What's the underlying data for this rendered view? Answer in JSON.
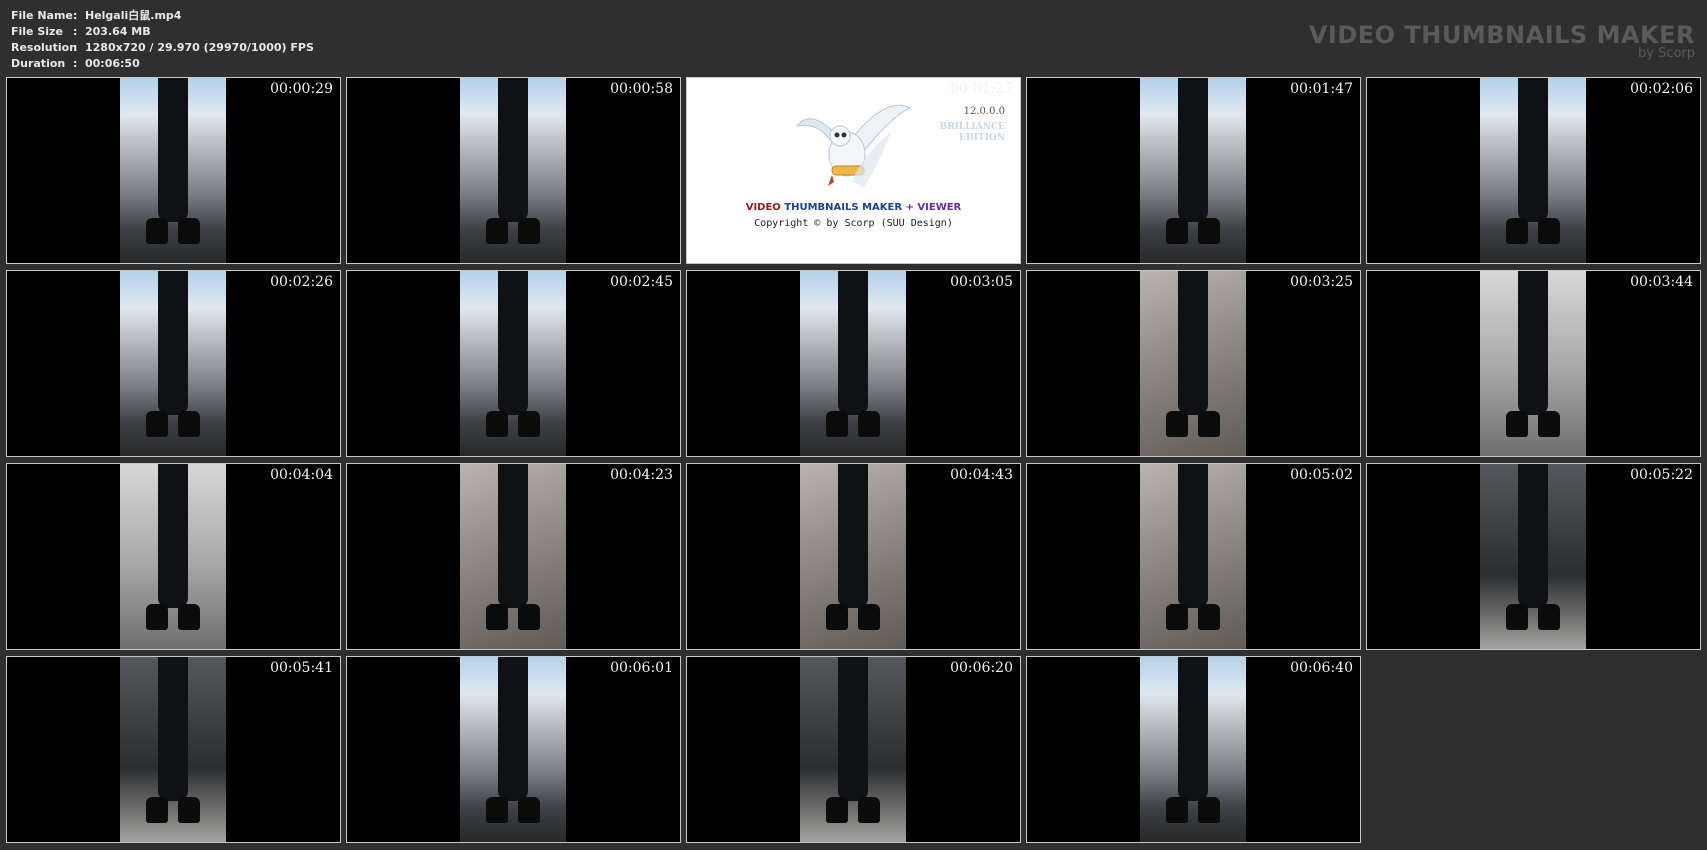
{
  "info": [
    {
      "label": "File Name",
      "sep": ":",
      "value": "Helgali白鼠.mp4"
    },
    {
      "label": "File Size",
      "sep": ":",
      "value": "203.64 MB"
    },
    {
      "label": "Resolution",
      "sep": ":",
      "value": "1280x720 / 29.970 (29970/1000) FPS"
    },
    {
      "label": "Duration",
      "sep": ":",
      "value": "00:06:50"
    }
  ],
  "brand": {
    "title": "VIDEO THUMBNAILS MAKER",
    "subtitle": "by Scorp"
  },
  "thumbnails": [
    {
      "time": "00:00:29",
      "scene": "street"
    },
    {
      "time": "00:00:58",
      "scene": "street"
    },
    {
      "time": "00:01:27",
      "scene": "logo"
    },
    {
      "time": "00:01:47",
      "scene": "street"
    },
    {
      "time": "00:02:06",
      "scene": "street"
    },
    {
      "time": "00:02:26",
      "scene": "street"
    },
    {
      "time": "00:02:45",
      "scene": "street"
    },
    {
      "time": "00:03:05",
      "scene": "street"
    },
    {
      "time": "00:03:25",
      "scene": "pavement"
    },
    {
      "time": "00:03:44",
      "scene": "wall"
    },
    {
      "time": "00:04:04",
      "scene": "wall"
    },
    {
      "time": "00:04:23",
      "scene": "pavement"
    },
    {
      "time": "00:04:43",
      "scene": "pavement"
    },
    {
      "time": "00:05:02",
      "scene": "pavement"
    },
    {
      "time": "00:05:22",
      "scene": "dark"
    },
    {
      "time": "00:05:41",
      "scene": "dark"
    },
    {
      "time": "00:06:01",
      "scene": "street"
    },
    {
      "time": "00:06:20",
      "scene": "dark"
    },
    {
      "time": "00:06:40",
      "scene": "street"
    }
  ],
  "logo": {
    "version": "12.0.0.0",
    "edition": "BRILLIANCE\nEDITION",
    "title_part1": "VIDEO",
    "title_part2": "THUMBNAILS MAKER",
    "title_part3": "+",
    "title_part4": "VIEWER",
    "copyright": "Copyright © by Scorp (SUU Design)",
    "colors": {
      "part1": "#9a1a1a",
      "part2": "#1e3f8a",
      "part3": "#6a2ea0",
      "part4": "#6a2ea0"
    }
  },
  "colors": {
    "background": "#2f2f2f",
    "info_text": "#e8e8e8",
    "brand_text": "#5a5a5a",
    "thumb_border": "#c8c8c8"
  }
}
